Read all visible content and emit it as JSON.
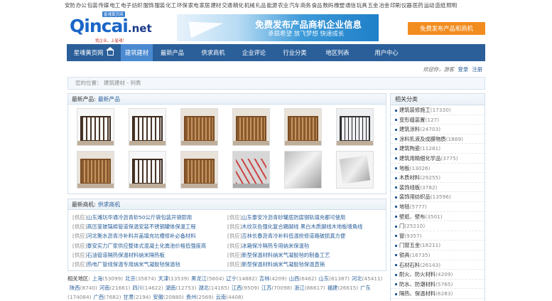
{
  "top_categories": [
    "安防",
    "办公",
    "包装",
    "传媒",
    "电工",
    "电子",
    "纺织",
    "服饰",
    "服装",
    "化工",
    "环保",
    "家电",
    "家居",
    "建材",
    "交通",
    "精化",
    "机械",
    "礼品",
    "能源",
    "农业",
    "汽车",
    "商务",
    "食品",
    "数码",
    "橡塑",
    "通信",
    "玩具",
    "五金",
    "冶金",
    "印刷",
    "仪器",
    "医药",
    "运动",
    "造纸",
    "照明"
  ],
  "logo": {
    "badge": "星魂黄页网",
    "brand": "Qincai",
    "tld": ".net",
    "slogan": "我企业，上星魂！"
  },
  "banner": {
    "title": "免费发布产品商机企业信息",
    "subtitle": "承载希望  放飞梦想  快速成长"
  },
  "cta_label": "免费发布产品和商机",
  "nav": [
    "星魂黄页网",
    "建筑建材",
    "最新产品",
    "供求商机",
    "企业评论",
    "行业分类",
    "地区列表",
    "用户中心"
  ],
  "welcome": {
    "text": "欢迎你，游客",
    "login": "登录",
    "register": "注册"
  },
  "breadcrumb": {
    "label": "您的位置：",
    "path": "建筑建材 - 列表"
  },
  "products_panel": {
    "title": "最新产品:",
    "link": "最新产品"
  },
  "business_panel": {
    "title": "最新商机:",
    "link": "供求商机"
  },
  "business_left": [
    {
      "tag": "[供应]",
      "text": "山东潍坊华通冷沥青砂50公斤袋包装开袋即用"
    },
    {
      "tag": "[供应]",
      "text": "高压釜玻璃棉管道保温安装不锈钢罐体保温工程"
    },
    {
      "tag": "[供应]",
      "text": "河北衡水沥青冷补料井盖填充坑槽修补必备材料"
    },
    {
      "tag": "[供应]",
      "text": "泰安实力厂家供应整体式混凝土化粪池价格低强度高"
    },
    {
      "tag": "[供应]",
      "text": "石油管道隔热保温材料纳米隔热板"
    },
    {
      "tag": "[供应]",
      "text": "热电厂管线保温专用纳米气凝胶毡保温毡"
    }
  ],
  "business_right": [
    {
      "tag": "[供应]",
      "text": "山东泰安冷沥青砂罐底防腐钢轨填充都可使用"
    },
    {
      "tag": "[供应]",
      "text": "木纹灰色强化复合踢脚线 黑白木质脚线木地板墙角线"
    },
    {
      "tag": "[供应]",
      "text": "吉林长春沥青冷补料低温抢修道路破损真方便"
    },
    {
      "tag": "[供应]",
      "text": "冰箱保冷隔热专用纳米保温毡"
    },
    {
      "tag": "[供应]",
      "text": "新型保温材料纳米气凝胶毡的制备工艺"
    },
    {
      "tag": "[供应]",
      "text": "新型保温材料纳米气凝胶毡保温直销"
    }
  ],
  "regions": {
    "label": "相关地区:",
    "items": [
      {
        "name": "上海",
        "count": "(53099)"
      },
      {
        "name": "北京",
        "count": "(35874)"
      },
      {
        "name": "天津",
        "count": "(13539)"
      },
      {
        "name": "黑龙江",
        "count": "(5604)"
      },
      {
        "name": "辽宁",
        "count": "(14882)"
      },
      {
        "name": "吉林",
        "count": "(4209)"
      },
      {
        "name": "山西",
        "count": "(6462)"
      },
      {
        "name": "山东",
        "count": "(61387)"
      },
      {
        "name": "河北",
        "count": "(45411)"
      },
      {
        "name": "陕西",
        "count": "(8740)"
      },
      {
        "name": "河南",
        "count": "(21661)"
      },
      {
        "name": "四川",
        "count": "(14622)"
      },
      {
        "name": "湖南",
        "count": "(12753)"
      },
      {
        "name": "湖北",
        "count": "(14165)"
      },
      {
        "name": "江西",
        "count": "(9509)"
      },
      {
        "name": "江苏",
        "count": "(70098)"
      },
      {
        "name": "浙江",
        "count": "(86617)"
      },
      {
        "name": "福建",
        "count": "(26615)"
      },
      {
        "name": "广东",
        "count": "(174084)"
      },
      {
        "name": "广西",
        "count": "(7682)"
      },
      {
        "name": "甘肃",
        "count": "(2194)"
      },
      {
        "name": "安徽",
        "count": "(20880)"
      },
      {
        "name": "贵州",
        "count": "(2569)"
      },
      {
        "name": "云南",
        "count": "(4408)"
      }
    ]
  },
  "sidebar": {
    "title": "相关分类",
    "items": [
      {
        "name": "建筑装修施工",
        "count": "(17330)"
      },
      {
        "name": "变形缝装置",
        "count": "(127)"
      },
      {
        "name": "建筑涂料",
        "count": "(24703)"
      },
      {
        "name": "涂料乳液及成膜物质",
        "count": "(1889)"
      },
      {
        "name": "建筑陶瓷",
        "count": "(11281)"
      },
      {
        "name": "建筑用精细化学品",
        "count": "(3775)"
      },
      {
        "name": "地板",
        "count": "(13026)"
      },
      {
        "name": "木质材料",
        "count": "(29255)"
      },
      {
        "name": "装饰线板",
        "count": "(3782)"
      },
      {
        "name": "装饰用纺织品",
        "count": "(13596)"
      },
      {
        "name": "地毯",
        "count": "(5777)"
      },
      {
        "name": "壁纸、壁布",
        "count": "(3501)"
      },
      {
        "name": "门",
        "count": "(25210)"
      },
      {
        "name": "窗",
        "count": "(9357)"
      },
      {
        "name": "门窗五金",
        "count": "(18211)"
      },
      {
        "name": "锁具",
        "count": "(16735)"
      },
      {
        "name": "石材石料",
        "count": "(26143)"
      },
      {
        "name": "耐火、防火材料",
        "count": "(4209)"
      },
      {
        "name": "防水、防潮材料",
        "count": "(5765)"
      },
      {
        "name": "隔热、保温材料",
        "count": "(6283)"
      }
    ]
  },
  "colors": {
    "nav_bg": "#2a5f9a",
    "nav_active": "#4a8ad1",
    "cta": "#f28c1f",
    "link": "#2a5f9a"
  }
}
